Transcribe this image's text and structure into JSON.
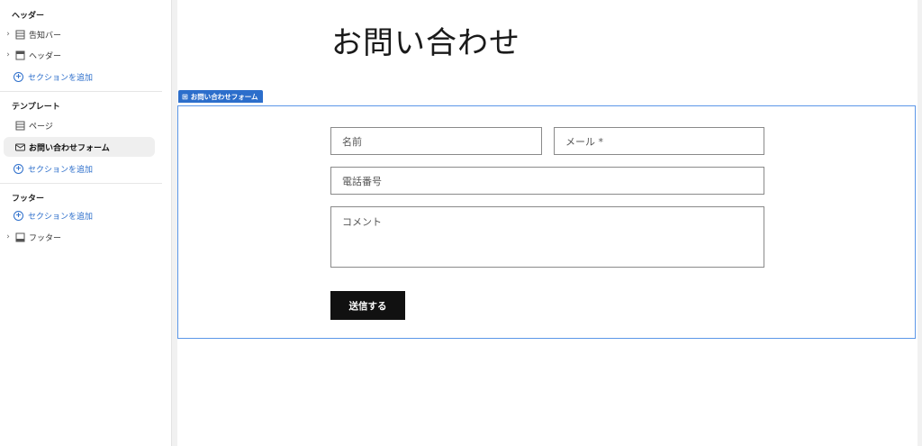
{
  "sidebar": {
    "header_group": {
      "title": "ヘッダー",
      "items": [
        {
          "label": "告知バー",
          "icon": "table-icon"
        },
        {
          "label": "ヘッダー",
          "icon": "header-layout-icon"
        }
      ],
      "add_label": "セクションを追加"
    },
    "template_group": {
      "title": "テンプレート",
      "items": [
        {
          "label": "ページ",
          "icon": "table-icon"
        },
        {
          "label": "お問い合わせフォーム",
          "icon": "mail-icon"
        }
      ],
      "add_label": "セクションを追加"
    },
    "footer_group": {
      "title": "フッター",
      "add_label": "セクションを追加",
      "items": [
        {
          "label": "フッター",
          "icon": "footer-layout-icon"
        }
      ]
    }
  },
  "preview": {
    "page_title": "お問い合わせ",
    "section_tag": "お問い合わせフォーム",
    "form": {
      "name_placeholder": "名前",
      "email_placeholder": "メール *",
      "phone_placeholder": "電話番号",
      "comment_placeholder": "コメント",
      "submit_label": "送信する"
    }
  },
  "colors": {
    "accent": "#2c6ecb",
    "selection_border": "#5b97e8",
    "button_bg": "#111111"
  }
}
